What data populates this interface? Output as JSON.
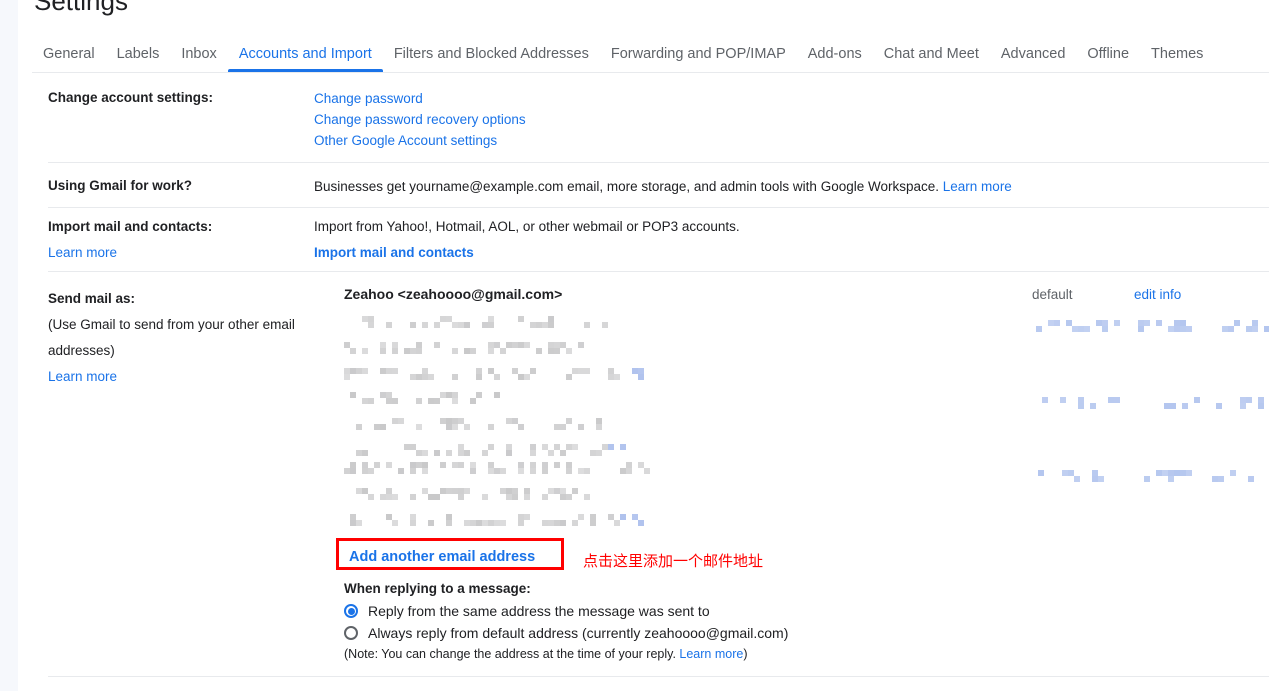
{
  "page": {
    "title": "Settings",
    "accent_blue": "#1a73e8",
    "annotation_red": "#ff0000"
  },
  "tabs": [
    {
      "label": "General",
      "active": false
    },
    {
      "label": "Labels",
      "active": false
    },
    {
      "label": "Inbox",
      "active": false
    },
    {
      "label": "Accounts and Import",
      "active": true
    },
    {
      "label": "Filters and Blocked Addresses",
      "active": false
    },
    {
      "label": "Forwarding and POP/IMAP",
      "active": false
    },
    {
      "label": "Add-ons",
      "active": false
    },
    {
      "label": "Chat and Meet",
      "active": false
    },
    {
      "label": "Advanced",
      "active": false
    },
    {
      "label": "Offline",
      "active": false
    },
    {
      "label": "Themes",
      "active": false
    }
  ],
  "sections": {
    "change_account": {
      "label": "Change account settings:",
      "links": [
        "Change password",
        "Change password recovery options",
        "Other Google Account settings"
      ]
    },
    "gmail_for_work": {
      "label": "Using Gmail for work?",
      "text": "Businesses get yourname@example.com email, more storage, and admin tools with Google Workspace.",
      "link": "Learn more"
    },
    "import_mail": {
      "label": "Import mail and contacts:",
      "label_link": "Learn more",
      "text": "Import from Yahoo!, Hotmail, AOL, or other webmail or POP3 accounts.",
      "action_link": "Import mail and contacts"
    },
    "send_mail_as": {
      "label": "Send mail as:",
      "note_line1": "(Use Gmail to send from your other email",
      "note_line2": "addresses)",
      "label_link": "Learn more",
      "primary_address": "Zeahoo <zeahoooo@gmail.com>",
      "col_default": "default",
      "col_edit_info": "edit info",
      "censored_note": "email address entries are pixelated/redacted in the screenshot",
      "add_button": "Add another email address",
      "annotation_cn": "点击这里添加一个邮件地址",
      "reply": {
        "title": "When replying to a message:",
        "options": [
          {
            "label": "Reply from the same address the message was sent to",
            "selected": true
          },
          {
            "label": "Always reply from default address (currently zeahoooo@gmail.com)",
            "selected": false
          }
        ],
        "note_prefix": "(Note: You can change the address at the time of your reply. ",
        "note_link": "Learn more",
        "note_suffix": ")"
      }
    }
  }
}
